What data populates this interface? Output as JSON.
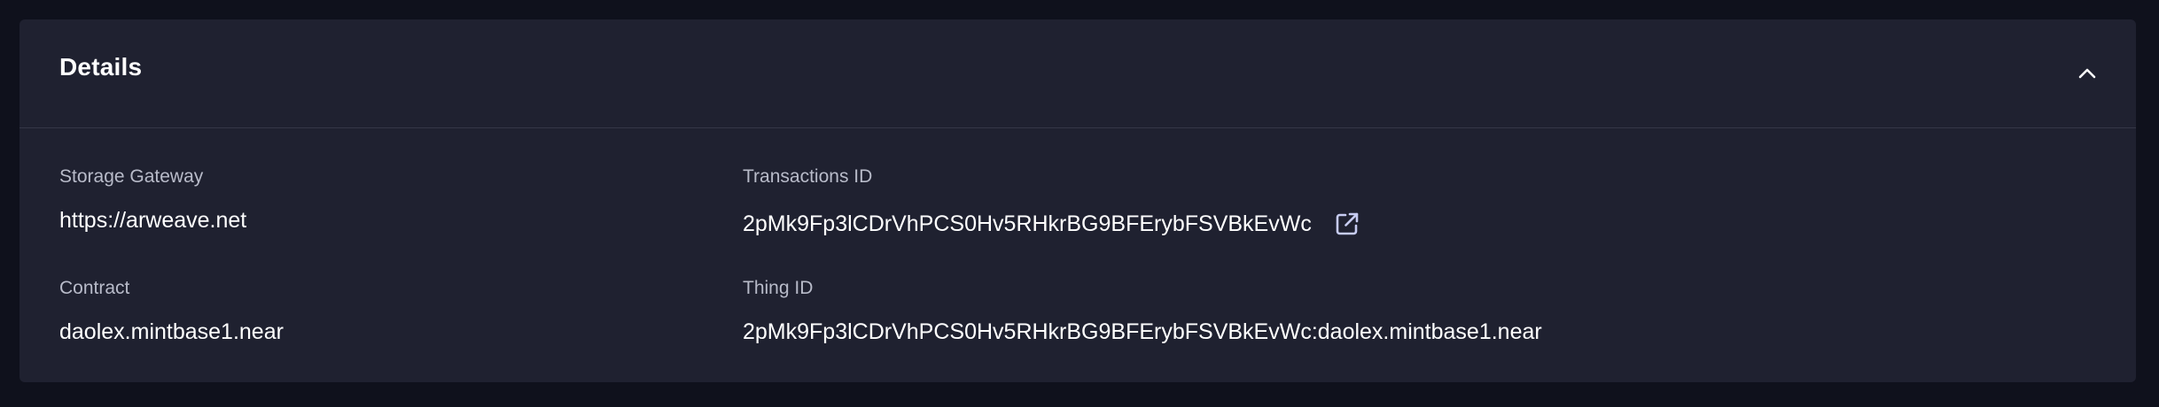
{
  "details": {
    "title": "Details",
    "toggle_icon": "chevron-up-icon",
    "fields": {
      "storage_gateway": {
        "label": "Storage Gateway",
        "value": "https://arweave.net"
      },
      "transactions_id": {
        "label": "Transactions ID",
        "value": "2pMk9Fp3lCDrVhPCS0Hv5RHkrBG9BFErybFSVBkEvWc",
        "link_icon": "external-link-icon"
      },
      "contract": {
        "label": "Contract",
        "value": "daolex.mintbase1.near"
      },
      "thing_id": {
        "label": "Thing ID",
        "value": "2pMk9Fp3lCDrVhPCS0Hv5RHkrBG9BFErybFSVBkEvWc:daolex.mintbase1.near"
      }
    }
  },
  "colors": {
    "page_background": "#0f111c",
    "panel_background": "#1f2130",
    "divider": "#343747",
    "label_text": "#b8bbc9",
    "value_text": "#ffffff",
    "icon_accent": "#c7ccf2"
  }
}
